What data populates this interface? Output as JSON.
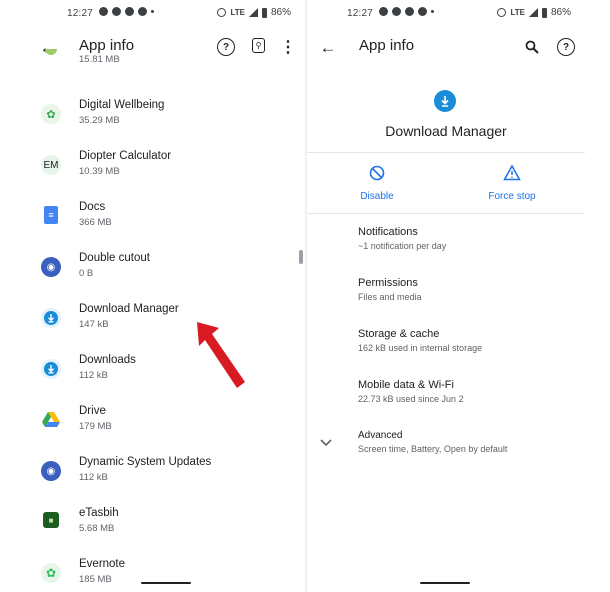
{
  "left": {
    "status": {
      "time": "12:27",
      "network": "LTE",
      "battery": "86%"
    },
    "appbar": {
      "title": "App info"
    },
    "apps": [
      {
        "name": "",
        "size": "15.81 MB",
        "icon": "partial-app-icon",
        "color": "#7cb342"
      },
      {
        "name": "Digital Wellbeing",
        "size": "35.29 MB",
        "icon": "digital-wellbeing-icon",
        "color": "#34a853"
      },
      {
        "name": "Diopter Calculator",
        "size": "10.39 MB",
        "icon": "diopter-calculator-icon",
        "color": "#e6f4ea",
        "glyph": "EM"
      },
      {
        "name": "Docs",
        "size": "366 MB",
        "icon": "docs-icon",
        "color": "#4285f4"
      },
      {
        "name": "Double cutout",
        "size": "0 B",
        "icon": "android-icon",
        "color": "#3b5fbf"
      },
      {
        "name": "Download Manager",
        "size": "147 kB",
        "icon": "download-manager-icon",
        "color": "#1a8cd8"
      },
      {
        "name": "Downloads",
        "size": "112 kB",
        "icon": "downloads-icon",
        "color": "#1a8cd8"
      },
      {
        "name": "Drive",
        "size": "179 MB",
        "icon": "drive-icon",
        "color": "#fbbc04"
      },
      {
        "name": "Dynamic System Updates",
        "size": "112 kB",
        "icon": "android-icon",
        "color": "#3b5fbf"
      },
      {
        "name": "eTasbih",
        "size": "5.68 MB",
        "icon": "etasbih-icon",
        "color": "#1b5e20"
      },
      {
        "name": "Evernote",
        "size": "185 MB",
        "icon": "evernote-icon",
        "color": "#2dbe60"
      }
    ]
  },
  "right": {
    "status": {
      "time": "12:27",
      "network": "LTE",
      "battery": "86%"
    },
    "appbar": {
      "title": "App info"
    },
    "app": {
      "name": "Download Manager",
      "color": "#1a8cd8"
    },
    "actions": {
      "disable": "Disable",
      "force_stop": "Force stop"
    },
    "prefs": [
      {
        "title": "Notifications",
        "summary": "~1 notification per day"
      },
      {
        "title": "Permissions",
        "summary": "Files and media"
      },
      {
        "title": "Storage & cache",
        "summary": "162 kB used in internal storage"
      },
      {
        "title": "Mobile data & Wi-Fi",
        "summary": "22.73 kB used since Jun 2"
      },
      {
        "title": "Advanced",
        "summary": "Screen time, Battery, Open by default"
      }
    ]
  },
  "colors": {
    "accent": "#1a73e8",
    "arrow": "#d81b23"
  }
}
